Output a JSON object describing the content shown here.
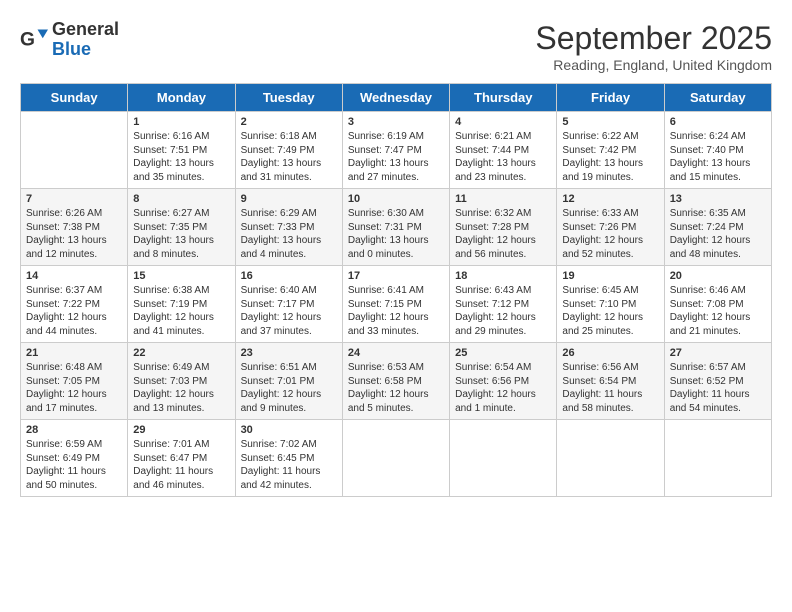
{
  "header": {
    "logo_general": "General",
    "logo_blue": "Blue",
    "month_title": "September 2025",
    "location": "Reading, England, United Kingdom"
  },
  "days_of_week": [
    "Sunday",
    "Monday",
    "Tuesday",
    "Wednesday",
    "Thursday",
    "Friday",
    "Saturday"
  ],
  "weeks": [
    [
      {
        "num": "",
        "info": ""
      },
      {
        "num": "1",
        "info": "Sunrise: 6:16 AM\nSunset: 7:51 PM\nDaylight: 13 hours\nand 35 minutes."
      },
      {
        "num": "2",
        "info": "Sunrise: 6:18 AM\nSunset: 7:49 PM\nDaylight: 13 hours\nand 31 minutes."
      },
      {
        "num": "3",
        "info": "Sunrise: 6:19 AM\nSunset: 7:47 PM\nDaylight: 13 hours\nand 27 minutes."
      },
      {
        "num": "4",
        "info": "Sunrise: 6:21 AM\nSunset: 7:44 PM\nDaylight: 13 hours\nand 23 minutes."
      },
      {
        "num": "5",
        "info": "Sunrise: 6:22 AM\nSunset: 7:42 PM\nDaylight: 13 hours\nand 19 minutes."
      },
      {
        "num": "6",
        "info": "Sunrise: 6:24 AM\nSunset: 7:40 PM\nDaylight: 13 hours\nand 15 minutes."
      }
    ],
    [
      {
        "num": "7",
        "info": "Sunrise: 6:26 AM\nSunset: 7:38 PM\nDaylight: 13 hours\nand 12 minutes."
      },
      {
        "num": "8",
        "info": "Sunrise: 6:27 AM\nSunset: 7:35 PM\nDaylight: 13 hours\nand 8 minutes."
      },
      {
        "num": "9",
        "info": "Sunrise: 6:29 AM\nSunset: 7:33 PM\nDaylight: 13 hours\nand 4 minutes."
      },
      {
        "num": "10",
        "info": "Sunrise: 6:30 AM\nSunset: 7:31 PM\nDaylight: 13 hours\nand 0 minutes."
      },
      {
        "num": "11",
        "info": "Sunrise: 6:32 AM\nSunset: 7:28 PM\nDaylight: 12 hours\nand 56 minutes."
      },
      {
        "num": "12",
        "info": "Sunrise: 6:33 AM\nSunset: 7:26 PM\nDaylight: 12 hours\nand 52 minutes."
      },
      {
        "num": "13",
        "info": "Sunrise: 6:35 AM\nSunset: 7:24 PM\nDaylight: 12 hours\nand 48 minutes."
      }
    ],
    [
      {
        "num": "14",
        "info": "Sunrise: 6:37 AM\nSunset: 7:22 PM\nDaylight: 12 hours\nand 44 minutes."
      },
      {
        "num": "15",
        "info": "Sunrise: 6:38 AM\nSunset: 7:19 PM\nDaylight: 12 hours\nand 41 minutes."
      },
      {
        "num": "16",
        "info": "Sunrise: 6:40 AM\nSunset: 7:17 PM\nDaylight: 12 hours\nand 37 minutes."
      },
      {
        "num": "17",
        "info": "Sunrise: 6:41 AM\nSunset: 7:15 PM\nDaylight: 12 hours\nand 33 minutes."
      },
      {
        "num": "18",
        "info": "Sunrise: 6:43 AM\nSunset: 7:12 PM\nDaylight: 12 hours\nand 29 minutes."
      },
      {
        "num": "19",
        "info": "Sunrise: 6:45 AM\nSunset: 7:10 PM\nDaylight: 12 hours\nand 25 minutes."
      },
      {
        "num": "20",
        "info": "Sunrise: 6:46 AM\nSunset: 7:08 PM\nDaylight: 12 hours\nand 21 minutes."
      }
    ],
    [
      {
        "num": "21",
        "info": "Sunrise: 6:48 AM\nSunset: 7:05 PM\nDaylight: 12 hours\nand 17 minutes."
      },
      {
        "num": "22",
        "info": "Sunrise: 6:49 AM\nSunset: 7:03 PM\nDaylight: 12 hours\nand 13 minutes."
      },
      {
        "num": "23",
        "info": "Sunrise: 6:51 AM\nSunset: 7:01 PM\nDaylight: 12 hours\nand 9 minutes."
      },
      {
        "num": "24",
        "info": "Sunrise: 6:53 AM\nSunset: 6:58 PM\nDaylight: 12 hours\nand 5 minutes."
      },
      {
        "num": "25",
        "info": "Sunrise: 6:54 AM\nSunset: 6:56 PM\nDaylight: 12 hours\nand 1 minute."
      },
      {
        "num": "26",
        "info": "Sunrise: 6:56 AM\nSunset: 6:54 PM\nDaylight: 11 hours\nand 58 minutes."
      },
      {
        "num": "27",
        "info": "Sunrise: 6:57 AM\nSunset: 6:52 PM\nDaylight: 11 hours\nand 54 minutes."
      }
    ],
    [
      {
        "num": "28",
        "info": "Sunrise: 6:59 AM\nSunset: 6:49 PM\nDaylight: 11 hours\nand 50 minutes."
      },
      {
        "num": "29",
        "info": "Sunrise: 7:01 AM\nSunset: 6:47 PM\nDaylight: 11 hours\nand 46 minutes."
      },
      {
        "num": "30",
        "info": "Sunrise: 7:02 AM\nSunset: 6:45 PM\nDaylight: 11 hours\nand 42 minutes."
      },
      {
        "num": "",
        "info": ""
      },
      {
        "num": "",
        "info": ""
      },
      {
        "num": "",
        "info": ""
      },
      {
        "num": "",
        "info": ""
      }
    ]
  ]
}
